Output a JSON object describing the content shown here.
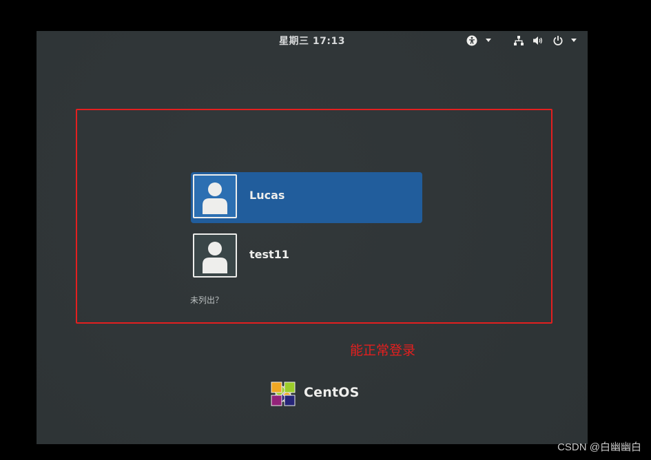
{
  "topbar": {
    "clock": "星期三 17:13",
    "icons": [
      "accessibility-icon",
      "network-icon",
      "volume-icon",
      "power-icon"
    ]
  },
  "users": [
    {
      "name": "Lucas",
      "selected": true
    },
    {
      "name": "test11",
      "selected": false
    }
  ],
  "not_listed": "未列出？",
  "annotation": {
    "text": "能正常登录",
    "color": "#e41f1f"
  },
  "logo": {
    "text": "CentOS"
  },
  "watermark": "CSDN @白幽幽白",
  "colors": {
    "background": "#2e3436",
    "selection": "#215d9c",
    "text": "#eeeeec"
  }
}
